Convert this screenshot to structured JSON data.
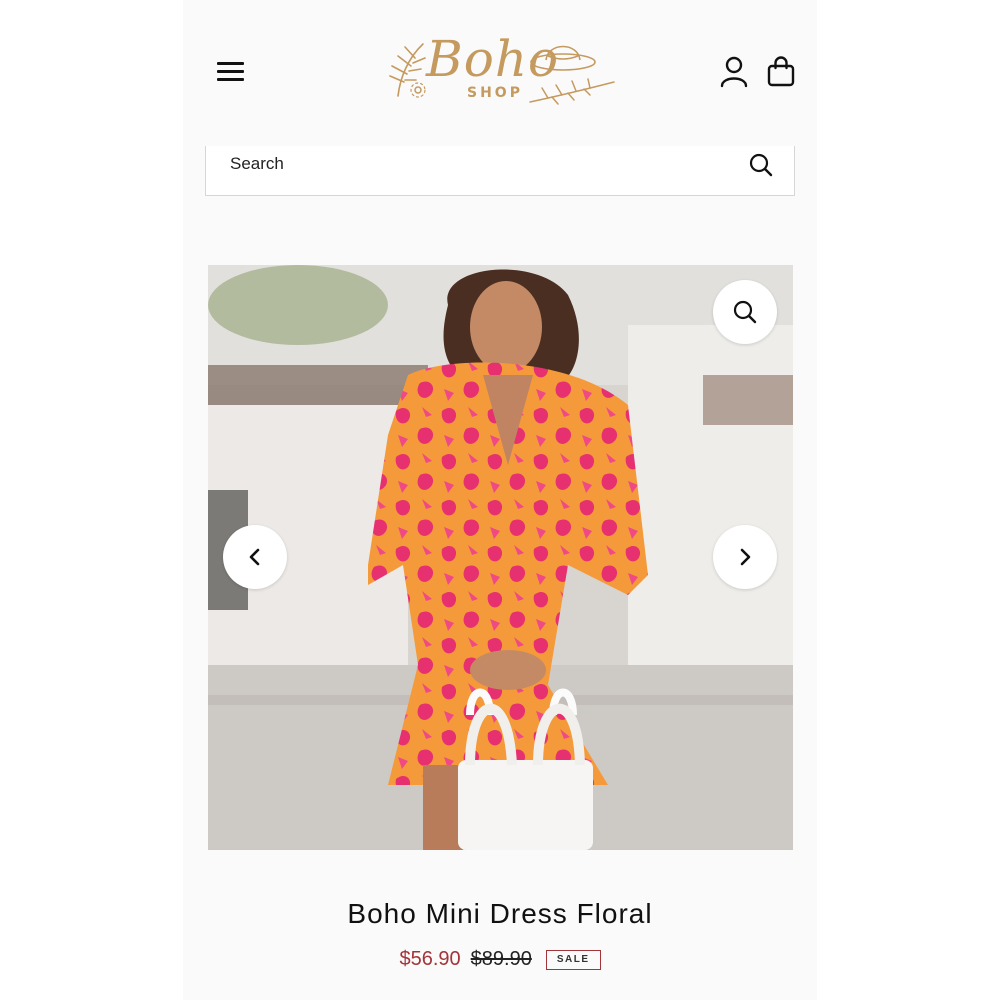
{
  "header": {
    "logo_word": "Boho",
    "logo_sub": "SHOP",
    "icons": {
      "menu": "hamburger-menu-icon",
      "account": "user-icon",
      "cart": "shopping-bag-icon"
    }
  },
  "search": {
    "placeholder": "Search",
    "icon": "search-icon"
  },
  "gallery": {
    "zoom_icon": "magnifier-icon",
    "prev_icon": "chevron-left-icon",
    "next_icon": "chevron-right-icon"
  },
  "product": {
    "title": "Boho Mini Dress Floral",
    "sale_price": "$56.90",
    "original_price": "$89.90",
    "badge": "SALE"
  },
  "colors": {
    "logo_gold": "#c49a5f",
    "sale_red": "#a3343a",
    "dress_pink": "#e6306f",
    "dress_orange": "#f59a3a"
  }
}
